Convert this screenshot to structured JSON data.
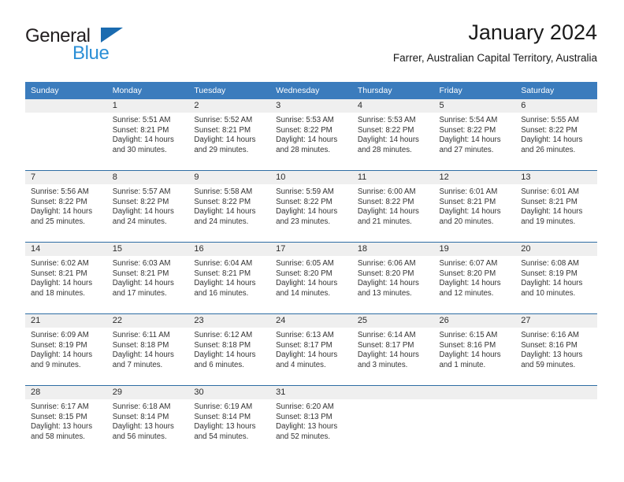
{
  "brand": {
    "name_dark": "General",
    "name_blue": "Blue",
    "accent_blue": "#2b8fd6",
    "triangle_blue": "#1a6bb0"
  },
  "header": {
    "title": "January 2024",
    "subtitle": "Farrer, Australian Capital Territory, Australia"
  },
  "theme": {
    "header_row_bg": "#3b7cbd",
    "day_band_bg": "#efefef",
    "row_divider": "#2e6da4",
    "text": "#333333"
  },
  "calendar": {
    "weekdays": [
      "Sunday",
      "Monday",
      "Tuesday",
      "Wednesday",
      "Thursday",
      "Friday",
      "Saturday"
    ],
    "weeks": [
      [
        {
          "day": "",
          "sunrise": "",
          "sunset": "",
          "daylight_1": "",
          "daylight_2": ""
        },
        {
          "day": "1",
          "sunrise": "Sunrise: 5:51 AM",
          "sunset": "Sunset: 8:21 PM",
          "daylight_1": "Daylight: 14 hours",
          "daylight_2": "and 30 minutes."
        },
        {
          "day": "2",
          "sunrise": "Sunrise: 5:52 AM",
          "sunset": "Sunset: 8:21 PM",
          "daylight_1": "Daylight: 14 hours",
          "daylight_2": "and 29 minutes."
        },
        {
          "day": "3",
          "sunrise": "Sunrise: 5:53 AM",
          "sunset": "Sunset: 8:22 PM",
          "daylight_1": "Daylight: 14 hours",
          "daylight_2": "and 28 minutes."
        },
        {
          "day": "4",
          "sunrise": "Sunrise: 5:53 AM",
          "sunset": "Sunset: 8:22 PM",
          "daylight_1": "Daylight: 14 hours",
          "daylight_2": "and 28 minutes."
        },
        {
          "day": "5",
          "sunrise": "Sunrise: 5:54 AM",
          "sunset": "Sunset: 8:22 PM",
          "daylight_1": "Daylight: 14 hours",
          "daylight_2": "and 27 minutes."
        },
        {
          "day": "6",
          "sunrise": "Sunrise: 5:55 AM",
          "sunset": "Sunset: 8:22 PM",
          "daylight_1": "Daylight: 14 hours",
          "daylight_2": "and 26 minutes."
        }
      ],
      [
        {
          "day": "7",
          "sunrise": "Sunrise: 5:56 AM",
          "sunset": "Sunset: 8:22 PM",
          "daylight_1": "Daylight: 14 hours",
          "daylight_2": "and 25 minutes."
        },
        {
          "day": "8",
          "sunrise": "Sunrise: 5:57 AM",
          "sunset": "Sunset: 8:22 PM",
          "daylight_1": "Daylight: 14 hours",
          "daylight_2": "and 24 minutes."
        },
        {
          "day": "9",
          "sunrise": "Sunrise: 5:58 AM",
          "sunset": "Sunset: 8:22 PM",
          "daylight_1": "Daylight: 14 hours",
          "daylight_2": "and 24 minutes."
        },
        {
          "day": "10",
          "sunrise": "Sunrise: 5:59 AM",
          "sunset": "Sunset: 8:22 PM",
          "daylight_1": "Daylight: 14 hours",
          "daylight_2": "and 23 minutes."
        },
        {
          "day": "11",
          "sunrise": "Sunrise: 6:00 AM",
          "sunset": "Sunset: 8:22 PM",
          "daylight_1": "Daylight: 14 hours",
          "daylight_2": "and 21 minutes."
        },
        {
          "day": "12",
          "sunrise": "Sunrise: 6:01 AM",
          "sunset": "Sunset: 8:21 PM",
          "daylight_1": "Daylight: 14 hours",
          "daylight_2": "and 20 minutes."
        },
        {
          "day": "13",
          "sunrise": "Sunrise: 6:01 AM",
          "sunset": "Sunset: 8:21 PM",
          "daylight_1": "Daylight: 14 hours",
          "daylight_2": "and 19 minutes."
        }
      ],
      [
        {
          "day": "14",
          "sunrise": "Sunrise: 6:02 AM",
          "sunset": "Sunset: 8:21 PM",
          "daylight_1": "Daylight: 14 hours",
          "daylight_2": "and 18 minutes."
        },
        {
          "day": "15",
          "sunrise": "Sunrise: 6:03 AM",
          "sunset": "Sunset: 8:21 PM",
          "daylight_1": "Daylight: 14 hours",
          "daylight_2": "and 17 minutes."
        },
        {
          "day": "16",
          "sunrise": "Sunrise: 6:04 AM",
          "sunset": "Sunset: 8:21 PM",
          "daylight_1": "Daylight: 14 hours",
          "daylight_2": "and 16 minutes."
        },
        {
          "day": "17",
          "sunrise": "Sunrise: 6:05 AM",
          "sunset": "Sunset: 8:20 PM",
          "daylight_1": "Daylight: 14 hours",
          "daylight_2": "and 14 minutes."
        },
        {
          "day": "18",
          "sunrise": "Sunrise: 6:06 AM",
          "sunset": "Sunset: 8:20 PM",
          "daylight_1": "Daylight: 14 hours",
          "daylight_2": "and 13 minutes."
        },
        {
          "day": "19",
          "sunrise": "Sunrise: 6:07 AM",
          "sunset": "Sunset: 8:20 PM",
          "daylight_1": "Daylight: 14 hours",
          "daylight_2": "and 12 minutes."
        },
        {
          "day": "20",
          "sunrise": "Sunrise: 6:08 AM",
          "sunset": "Sunset: 8:19 PM",
          "daylight_1": "Daylight: 14 hours",
          "daylight_2": "and 10 minutes."
        }
      ],
      [
        {
          "day": "21",
          "sunrise": "Sunrise: 6:09 AM",
          "sunset": "Sunset: 8:19 PM",
          "daylight_1": "Daylight: 14 hours",
          "daylight_2": "and 9 minutes."
        },
        {
          "day": "22",
          "sunrise": "Sunrise: 6:11 AM",
          "sunset": "Sunset: 8:18 PM",
          "daylight_1": "Daylight: 14 hours",
          "daylight_2": "and 7 minutes."
        },
        {
          "day": "23",
          "sunrise": "Sunrise: 6:12 AM",
          "sunset": "Sunset: 8:18 PM",
          "daylight_1": "Daylight: 14 hours",
          "daylight_2": "and 6 minutes."
        },
        {
          "day": "24",
          "sunrise": "Sunrise: 6:13 AM",
          "sunset": "Sunset: 8:17 PM",
          "daylight_1": "Daylight: 14 hours",
          "daylight_2": "and 4 minutes."
        },
        {
          "day": "25",
          "sunrise": "Sunrise: 6:14 AM",
          "sunset": "Sunset: 8:17 PM",
          "daylight_1": "Daylight: 14 hours",
          "daylight_2": "and 3 minutes."
        },
        {
          "day": "26",
          "sunrise": "Sunrise: 6:15 AM",
          "sunset": "Sunset: 8:16 PM",
          "daylight_1": "Daylight: 14 hours",
          "daylight_2": "and 1 minute."
        },
        {
          "day": "27",
          "sunrise": "Sunrise: 6:16 AM",
          "sunset": "Sunset: 8:16 PM",
          "daylight_1": "Daylight: 13 hours",
          "daylight_2": "and 59 minutes."
        }
      ],
      [
        {
          "day": "28",
          "sunrise": "Sunrise: 6:17 AM",
          "sunset": "Sunset: 8:15 PM",
          "daylight_1": "Daylight: 13 hours",
          "daylight_2": "and 58 minutes."
        },
        {
          "day": "29",
          "sunrise": "Sunrise: 6:18 AM",
          "sunset": "Sunset: 8:14 PM",
          "daylight_1": "Daylight: 13 hours",
          "daylight_2": "and 56 minutes."
        },
        {
          "day": "30",
          "sunrise": "Sunrise: 6:19 AM",
          "sunset": "Sunset: 8:14 PM",
          "daylight_1": "Daylight: 13 hours",
          "daylight_2": "and 54 minutes."
        },
        {
          "day": "31",
          "sunrise": "Sunrise: 6:20 AM",
          "sunset": "Sunset: 8:13 PM",
          "daylight_1": "Daylight: 13 hours",
          "daylight_2": "and 52 minutes."
        },
        {
          "day": "",
          "sunrise": "",
          "sunset": "",
          "daylight_1": "",
          "daylight_2": ""
        },
        {
          "day": "",
          "sunrise": "",
          "sunset": "",
          "daylight_1": "",
          "daylight_2": ""
        },
        {
          "day": "",
          "sunrise": "",
          "sunset": "",
          "daylight_1": "",
          "daylight_2": ""
        }
      ]
    ]
  }
}
